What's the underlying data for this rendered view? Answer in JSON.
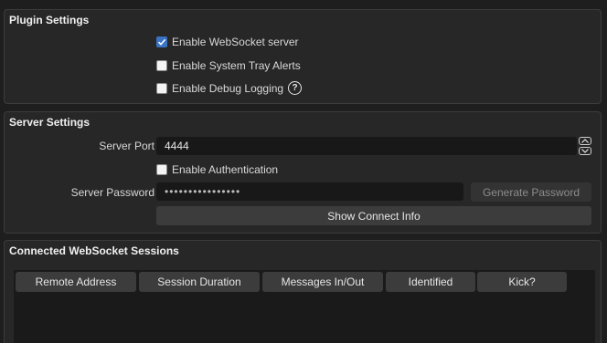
{
  "plugin_settings": {
    "title": "Plugin Settings",
    "enable_websocket_label": "Enable WebSocket server",
    "enable_websocket_checked": true,
    "enable_tray_label": "Enable System Tray Alerts",
    "enable_tray_checked": false,
    "enable_debug_label": "Enable Debug Logging",
    "enable_debug_checked": false,
    "help_glyph": "?"
  },
  "server_settings": {
    "title": "Server Settings",
    "port_label": "Server Port",
    "port_value": "4444",
    "auth_label": "Enable Authentication",
    "auth_checked": false,
    "password_label": "Server Password",
    "password_value": "••••••••••••••••",
    "generate_password_label": "Generate Password",
    "show_connect_info_label": "Show Connect Info"
  },
  "sessions": {
    "title": "Connected WebSocket Sessions",
    "columns": [
      "Remote Address",
      "Session Duration",
      "Messages In/Out",
      "Identified",
      "Kick?"
    ]
  },
  "colors": {
    "accent": "#3a72c4",
    "background": "#1e1e1e",
    "panel": "#272727"
  }
}
